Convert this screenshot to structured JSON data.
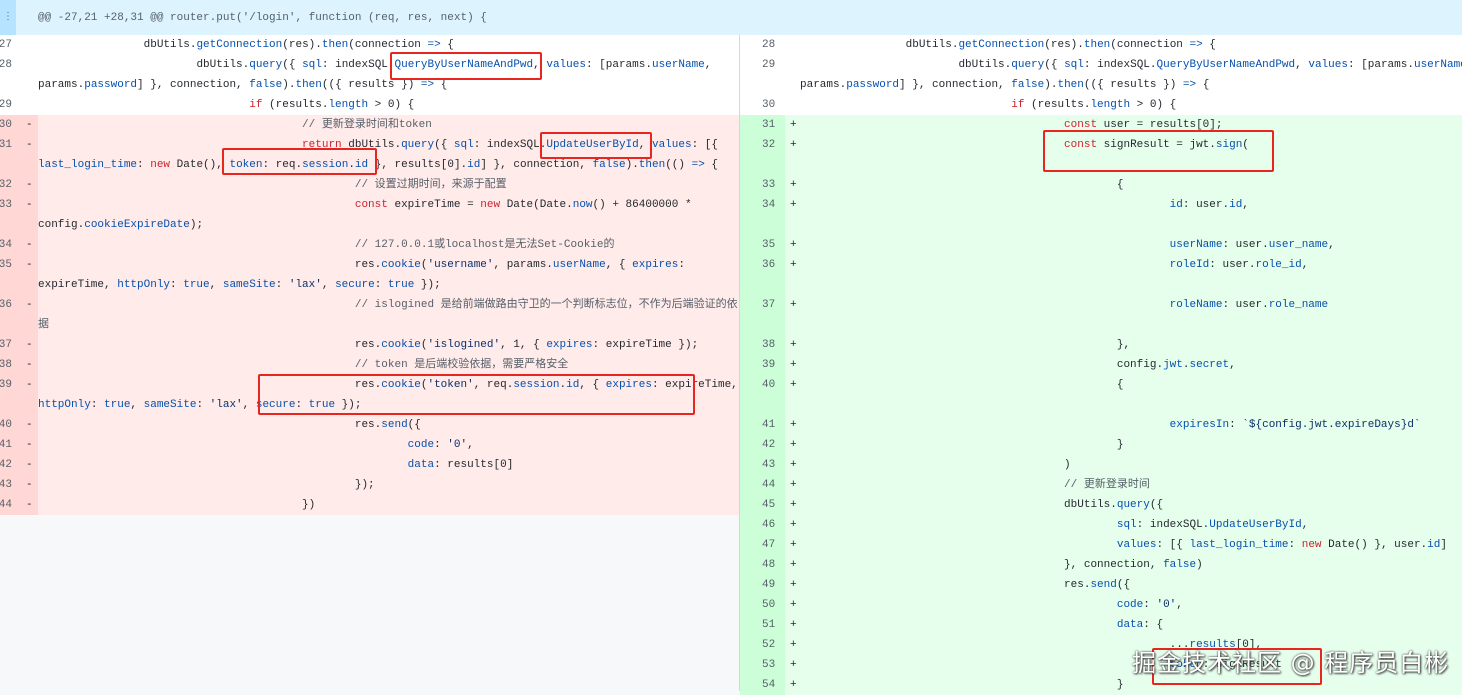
{
  "hunk_header": "@@ -27,21 +28,31 @@ router.put('/login', function (req, res, next) {",
  "expand_icon": "ellipsis-icon",
  "watermark": "掘金技术社区 @ 程序员白彬",
  "colors": {
    "deletion": "#ffebe9",
    "addition": "#e6ffec",
    "highlight_box": "#e8261f"
  },
  "rows": [
    {
      "l": {
        "n": 27,
        "t": "ctx",
        "c": "\t\tdbUtils.getConnection(res).then(connection => {"
      },
      "r": {
        "n": 28,
        "t": "ctx",
        "c": "\t\tdbUtils.getConnection(res).then(connection => {"
      }
    },
    {
      "l": {
        "n": 28,
        "t": "ctx",
        "c": "\t\t\tdbUtils.query({ sql: indexSQL.QueryByUserNameAndPwd, values: [params.userName, params.password] }, connection, false).then(({ results }) => {"
      },
      "r": {
        "n": 29,
        "t": "ctx",
        "c": "\t\t\tdbUtils.query({ sql: indexSQL.QueryByUserNameAndPwd, values: [params.userName, params.password] }, connection, false).then(({ results }) => {"
      }
    },
    {
      "l": {
        "n": 29,
        "t": "ctx",
        "c": "\t\t\t\tif (results.length > 0) {"
      },
      "r": {
        "n": 30,
        "t": "ctx",
        "c": "\t\t\t\tif (results.length > 0) {"
      }
    },
    {
      "l": {
        "n": 30,
        "t": "del",
        "c": "\t\t\t\t\t// 更新登录时间和token"
      },
      "r": {
        "n": 31,
        "t": "add",
        "c": "\t\t\t\t\tconst user = results[0];"
      }
    },
    {
      "l": {
        "n": 31,
        "t": "del",
        "c": "\t\t\t\t\treturn dbUtils.query({ sql: indexSQL.UpdateUserById, values: [{ last_login_time: new Date(), token: req.session.id }, results[0].id] }, connection, false).then(() => {"
      },
      "r": {
        "n": 32,
        "t": "add",
        "c": "\t\t\t\t\tconst signResult = jwt.sign("
      }
    },
    {
      "l": {
        "n": 32,
        "t": "del",
        "c": "\t\t\t\t\t\t// 设置过期时间，来源于配置"
      },
      "r": {
        "n": 33,
        "t": "add",
        "c": "\t\t\t\t\t\t{"
      }
    },
    {
      "l": {
        "n": 33,
        "t": "del",
        "c": "\t\t\t\t\t\tconst expireTime = new Date(Date.now() + 86400000 * config.cookieExpireDate);"
      },
      "r": {
        "n": 34,
        "t": "add",
        "c": "\t\t\t\t\t\t\tid: user.id,"
      }
    },
    {
      "l": {
        "n": 34,
        "t": "del",
        "c": "\t\t\t\t\t\t// 127.0.0.1或localhost是无法Set-Cookie的"
      },
      "r": {
        "n": 35,
        "t": "add",
        "c": "\t\t\t\t\t\t\tuserName: user.user_name,"
      }
    },
    {
      "l": {
        "n": 35,
        "t": "del",
        "c": "\t\t\t\t\t\tres.cookie('username', params.userName, { expires: expireTime, httpOnly: true, sameSite: 'lax', secure: true });"
      },
      "r": {
        "n": 36,
        "t": "add",
        "c": "\t\t\t\t\t\t\troleId: user.role_id,"
      }
    },
    {
      "l": {
        "n": 36,
        "t": "del",
        "c": "\t\t\t\t\t\t// islogined 是给前端做路由守卫的一个判断标志位，不作为后端验证的依据"
      },
      "r": {
        "n": 37,
        "t": "add",
        "c": "\t\t\t\t\t\t\troleName: user.role_name"
      }
    },
    {
      "l": {
        "n": 37,
        "t": "del",
        "c": "\t\t\t\t\t\tres.cookie('islogined', 1, { expires: expireTime });"
      },
      "r": {
        "n": 38,
        "t": "add",
        "c": "\t\t\t\t\t\t},"
      }
    },
    {
      "l": {
        "n": 38,
        "t": "del",
        "c": "\t\t\t\t\t\t// token 是后端校验依据，需要严格安全"
      },
      "r": {
        "n": 39,
        "t": "add",
        "c": "\t\t\t\t\t\tconfig.jwt.secret,"
      }
    },
    {
      "l": {
        "n": 39,
        "t": "del",
        "c": "\t\t\t\t\t\tres.cookie('token', req.session.id, { expires: expireTime, httpOnly: true, sameSite: 'lax', secure: true });"
      },
      "r": {
        "n": 40,
        "t": "add",
        "c": "\t\t\t\t\t\t{"
      }
    },
    {
      "l": {
        "n": 40,
        "t": "del",
        "c": "\t\t\t\t\t\tres.send({"
      },
      "r": {
        "n": 41,
        "t": "add",
        "c": "\t\t\t\t\t\t\texpiresIn: `${config.jwt.expireDays}d`"
      }
    },
    {
      "l": {
        "n": 41,
        "t": "del",
        "c": "\t\t\t\t\t\t\tcode: '0',"
      },
      "r": {
        "n": 42,
        "t": "add",
        "c": "\t\t\t\t\t\t}"
      }
    },
    {
      "l": {
        "n": 42,
        "t": "del",
        "c": "\t\t\t\t\t\t\tdata: results[0]"
      },
      "r": {
        "n": 43,
        "t": "add",
        "c": "\t\t\t\t\t)"
      }
    },
    {
      "l": {
        "n": 43,
        "t": "del",
        "c": "\t\t\t\t\t\t});"
      },
      "r": {
        "n": 44,
        "t": "add",
        "c": "\t\t\t\t\t// 更新登录时间"
      }
    },
    {
      "l": {
        "n": 44,
        "t": "del",
        "c": "\t\t\t\t\t})"
      },
      "r": {
        "n": 45,
        "t": "add",
        "c": "\t\t\t\t\tdbUtils.query({"
      }
    },
    {
      "l": null,
      "r": {
        "n": 46,
        "t": "add",
        "c": "\t\t\t\t\t\tsql: indexSQL.UpdateUserById,"
      }
    },
    {
      "l": null,
      "r": {
        "n": 47,
        "t": "add",
        "c": "\t\t\t\t\t\tvalues: [{ last_login_time: new Date() }, user.id]"
      }
    },
    {
      "l": null,
      "r": {
        "n": 48,
        "t": "add",
        "c": "\t\t\t\t\t}, connection, false)"
      }
    },
    {
      "l": null,
      "r": {
        "n": 49,
        "t": "add",
        "c": "\t\t\t\t\tres.send({"
      }
    },
    {
      "l": null,
      "r": {
        "n": 50,
        "t": "add",
        "c": "\t\t\t\t\t\tcode: '0',"
      }
    },
    {
      "l": null,
      "r": {
        "n": 51,
        "t": "add",
        "c": "\t\t\t\t\t\tdata: {"
      }
    },
    {
      "l": null,
      "r": {
        "n": 52,
        "t": "add",
        "c": "\t\t\t\t\t\t\t...results[0],"
      }
    },
    {
      "l": null,
      "r": {
        "n": 53,
        "t": "add",
        "c": "\t\t\t\t\t\t\ttoken: signResult"
      }
    },
    {
      "l": null,
      "r": {
        "n": 54,
        "t": "add",
        "c": "\t\t\t\t\t\t}"
      }
    }
  ]
}
